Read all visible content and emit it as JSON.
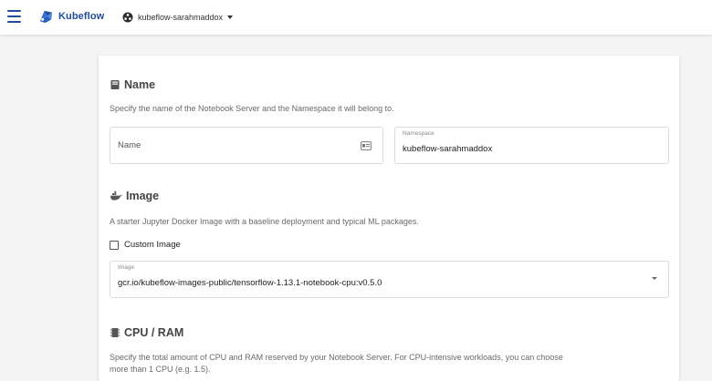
{
  "topbar": {
    "app_name": "Kubeflow",
    "namespace": "kubeflow-sarahmaddox"
  },
  "sections": {
    "name": {
      "title": "Name",
      "description": "Specify the name of the Notebook Server and the Namespace it will belong to.",
      "name_field_placeholder": "Name",
      "namespace_label": "Namespace",
      "namespace_value": "kubeflow-sarahmaddox"
    },
    "image": {
      "title": "Image",
      "description": "A starter Jupyter Docker Image with a baseline deployment and typical ML packages.",
      "custom_image_label": "Custom Image",
      "image_label": "Image",
      "image_value": "gcr.io/kubeflow-images-public/tensorflow-1.13.1-notebook-cpu:v0.5.0"
    },
    "cpu_ram": {
      "title": "CPU / RAM",
      "description_line1": "Specify the total amount of CPU and RAM reserved by your Notebook Server. For CPU-intensive workloads, you can choose",
      "description_line2": "more than 1 CPU (e.g. 1.5)."
    }
  },
  "colors": {
    "brand": "#1f4e9c",
    "background": "#f4f4f4",
    "card": "#ffffff"
  },
  "icons": {
    "menu": "hamburger-menu-icon",
    "logo": "kubeflow-logo-icon",
    "namespace": "namespace-icon",
    "name_section": "book-icon",
    "name_field": "badge-icon",
    "image_section": "docker-icon",
    "cpu_section": "memory-chip-icon"
  }
}
